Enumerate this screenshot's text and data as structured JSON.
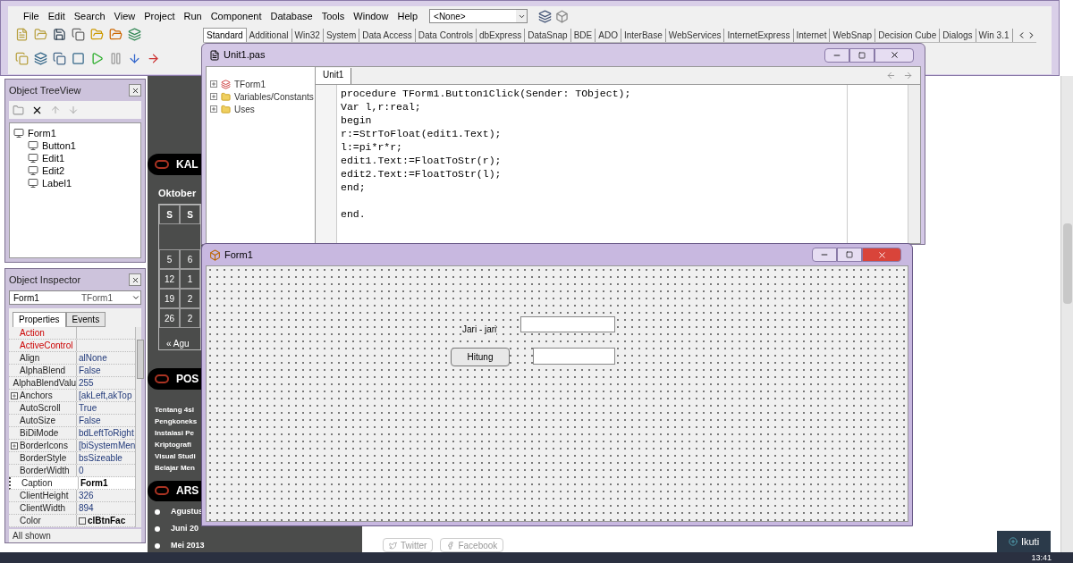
{
  "ide": {
    "menu": [
      "File",
      "Edit",
      "Search",
      "View",
      "Project",
      "Run",
      "Component",
      "Database",
      "Tools",
      "Window",
      "Help"
    ],
    "combo": {
      "value": "<None>"
    },
    "palette_tabs": [
      {
        "label": "Standard",
        "selected": true
      },
      {
        "label": "Additional",
        "selected": false
      },
      {
        "label": "Win32",
        "selected": false
      },
      {
        "label": "System",
        "selected": false
      },
      {
        "label": "Data Access",
        "selected": false
      },
      {
        "label": "Data Controls",
        "selected": false
      },
      {
        "label": "dbExpress",
        "selected": false
      },
      {
        "label": "DataSnap",
        "selected": false
      },
      {
        "label": "BDE",
        "selected": false
      },
      {
        "label": "ADO",
        "selected": false
      },
      {
        "label": "InterBase",
        "selected": false
      },
      {
        "label": "WebServices",
        "selected": false
      },
      {
        "label": "InternetExpress",
        "selected": false
      },
      {
        "label": "Internet",
        "selected": false
      },
      {
        "label": "WebSnap",
        "selected": false
      },
      {
        "label": "Decision Cube",
        "selected": false
      },
      {
        "label": "Dialogs",
        "selected": false
      },
      {
        "label": "Win 3.1",
        "selected": false
      }
    ]
  },
  "tree_view": {
    "title": "Object TreeView",
    "items": [
      {
        "label": "Form1",
        "children": [
          {
            "label": "Button1"
          },
          {
            "label": "Edit1"
          },
          {
            "label": "Edit2"
          },
          {
            "label": "Label1"
          }
        ]
      }
    ]
  },
  "inspector": {
    "title": "Object Inspector",
    "object": "Form1",
    "object_type": "TForm1",
    "tabs": [
      {
        "label": "Properties",
        "selected": true
      },
      {
        "label": "Events",
        "selected": false
      }
    ],
    "properties": [
      {
        "name": "Action",
        "kind": "reference",
        "selected": false,
        "expandable": false
      },
      {
        "name": "ActiveControl",
        "kind": "reference",
        "selected": false,
        "expandable": false
      },
      {
        "name": "Align",
        "value": "alNone",
        "kind": "plain",
        "selected": false,
        "expandable": false
      },
      {
        "name": "AlphaBlend",
        "value": "False",
        "kind": "plain",
        "selected": false,
        "expandable": false
      },
      {
        "name": "AlphaBlendValu",
        "value": "255",
        "kind": "plain",
        "selected": false,
        "expandable": false
      },
      {
        "name": "Anchors",
        "value": "[akLeft,akTop",
        "kind": "plain",
        "selected": false,
        "expandable": true
      },
      {
        "name": "AutoScroll",
        "value": "True",
        "kind": "plain",
        "selected": false,
        "expandable": false
      },
      {
        "name": "AutoSize",
        "value": "False",
        "kind": "plain",
        "selected": false,
        "expandable": false
      },
      {
        "name": "BiDiMode",
        "value": "bdLeftToRight",
        "kind": "plain",
        "selected": false,
        "expandable": false
      },
      {
        "name": "BorderIcons",
        "value": "[biSystemMen",
        "kind": "plain",
        "selected": false,
        "expandable": true
      },
      {
        "name": "BorderStyle",
        "value": "bsSizeable",
        "kind": "plain",
        "selected": false,
        "expandable": false
      },
      {
        "name": "BorderWidth",
        "value": "0",
        "kind": "plain",
        "selected": false,
        "expandable": false
      },
      {
        "name": "Caption",
        "value": "Form1",
        "kind": "plain",
        "selected": true,
        "expandable": false
      },
      {
        "name": "ClientHeight",
        "value": "326",
        "kind": "plain",
        "selected": false,
        "expandable": false
      },
      {
        "name": "ClientWidth",
        "value": "894",
        "kind": "plain",
        "selected": false,
        "expandable": false
      },
      {
        "name": "Color",
        "value": "clBtnFac",
        "kind": "color",
        "selected": false,
        "expandable": false
      }
    ],
    "status": "All shown"
  },
  "blog": {
    "calendar_heading": "KAL",
    "month": "Oktober",
    "weekdays": [
      "S",
      "S"
    ],
    "weeks": [
      [
        "5",
        "6"
      ],
      [
        "12",
        "1"
      ],
      [
        "19",
        "2"
      ],
      [
        "26",
        "2"
      ]
    ],
    "calendar_nav": "« Agu",
    "posts_heading": "POS",
    "posts": [
      "Tentang 4sl",
      "Pengkoneks",
      "Instalasi Pe",
      "Kriptografi",
      "Visual Studi",
      "Belajar Men"
    ],
    "archive_heading": "ARS",
    "archives": [
      "Agustus",
      "Juni 20",
      "Mei 2013"
    ],
    "share": [
      "Twitter",
      "Facebook"
    ],
    "follow": "Ikuti"
  },
  "unit_window": {
    "title": "Unit1.pas",
    "explorer": [
      {
        "label": "TForm1",
        "kind": "class"
      },
      {
        "label": "Variables/Constants",
        "kind": "folder"
      },
      {
        "label": "Uses",
        "kind": "folder"
      }
    ],
    "tabs": [
      {
        "label": "Unit1",
        "selected": true
      }
    ],
    "code_blocks": [
      [
        "procedure TForm1.Button1Click(Sender: TObject);",
        "Var l,r:real;",
        "begin",
        "r:=StrToFloat(edit1.Text);",
        "l:=pi*r*r;",
        "edit1.Text:=FloatToStr(r);",
        "edit2.Text:=FloatToStr(l);",
        "end;"
      ],
      [
        "end."
      ]
    ]
  },
  "form_window": {
    "title": "Form1",
    "label": "Jari - jari",
    "button": "Hitung"
  },
  "taskbar": {
    "clock": "13:41"
  }
}
